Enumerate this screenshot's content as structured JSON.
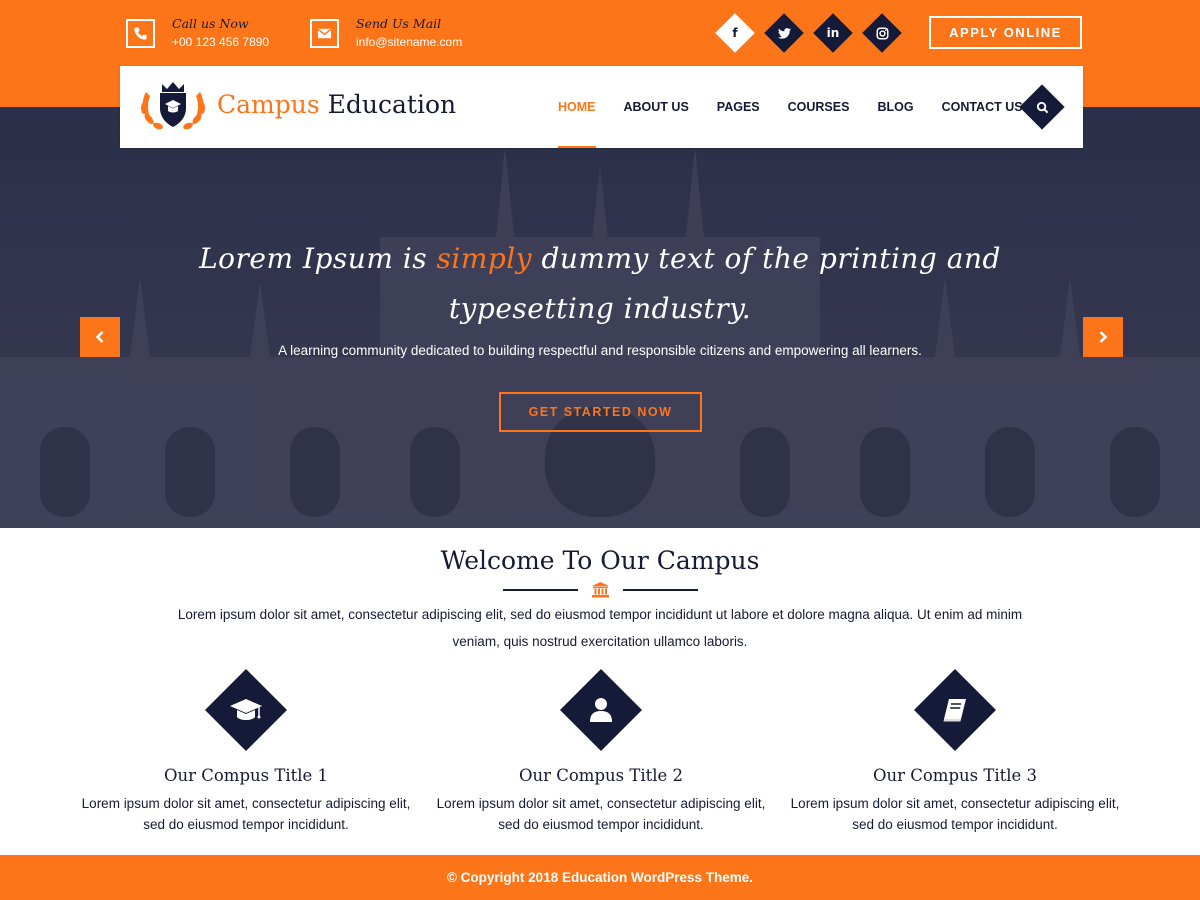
{
  "colors": {
    "accent": "#fd7519",
    "dark": "#151a38",
    "hero_overlay": "#2f3350"
  },
  "topbar": {
    "call": {
      "title": "Call us Now",
      "value": "+00 123 456 7890",
      "icon": "phone-icon"
    },
    "mail": {
      "title": "Send Us Mail",
      "value": "info@sitename.com",
      "icon": "envelope-icon"
    },
    "socials": [
      {
        "icon": "facebook-icon",
        "glyph": "f"
      },
      {
        "icon": "twitter-icon",
        "glyph": ""
      },
      {
        "icon": "linkedin-icon",
        "glyph": "in"
      },
      {
        "icon": "instagram-icon",
        "glyph": ""
      }
    ],
    "apply_label": "APPLY ONLINE"
  },
  "header": {
    "brand_part1": "Campus",
    "brand_part2": "Education",
    "nav": [
      "HOME",
      "ABOUT US",
      "PAGES",
      "COURSES",
      "BLOG",
      "CONTACT US"
    ],
    "active_nav": "HOME"
  },
  "hero": {
    "title_before": "Lorem Ipsum is ",
    "title_accent": "simply",
    "title_after": " dummy text of the printing and typesetting industry.",
    "subtitle": "A learning community dedicated to building respectful and responsible citizens and empowering all learners.",
    "cta_label": "GET STARTED NOW"
  },
  "welcome": {
    "title": "Welcome To Our Campus",
    "text": "Lorem ipsum dolor sit amet, consectetur adipiscing elit, sed do eiusmod tempor incididunt ut labore et dolore magna aliqua. Ut enim ad minim veniam, quis nostrud exercitation ullamco laboris."
  },
  "features": [
    {
      "title": "Our Compus Title 1",
      "text": "Lorem ipsum dolor sit amet, consectetur adipiscing elit, sed do eiusmod tempor incididunt.",
      "icon": "graduation-cap-icon"
    },
    {
      "title": "Our Compus Title 2",
      "text": "Lorem ipsum dolor sit amet, consectetur adipiscing elit, sed do eiusmod tempor incididunt.",
      "icon": "user-icon"
    },
    {
      "title": "Our Compus Title 3",
      "text": "Lorem ipsum dolor sit amet, consectetur adipiscing elit, sed do eiusmod tempor incididunt.",
      "icon": "book-icon"
    }
  ],
  "footer": {
    "copyright": "© Copyright 2018 Education WordPress Theme."
  }
}
